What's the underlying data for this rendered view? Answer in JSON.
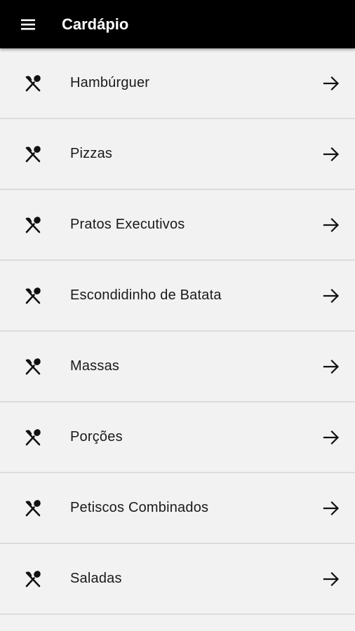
{
  "header": {
    "title": "Cardápio",
    "menu_icon": "menu-icon"
  },
  "menu": {
    "item_icon": "restaurant-icon",
    "chevron_icon": "arrow-right-icon",
    "items": [
      {
        "label": "Hambúrguer"
      },
      {
        "label": "Pizzas"
      },
      {
        "label": "Pratos Executivos"
      },
      {
        "label": "Escondidinho de Batata"
      },
      {
        "label": "Massas"
      },
      {
        "label": "Porções"
      },
      {
        "label": "Petiscos Combinados"
      },
      {
        "label": "Saladas"
      }
    ]
  },
  "colors": {
    "appbar": "#000000",
    "background": "#f2f2f2",
    "divider": "#dcdcdc",
    "text": "#1a1a1a"
  }
}
